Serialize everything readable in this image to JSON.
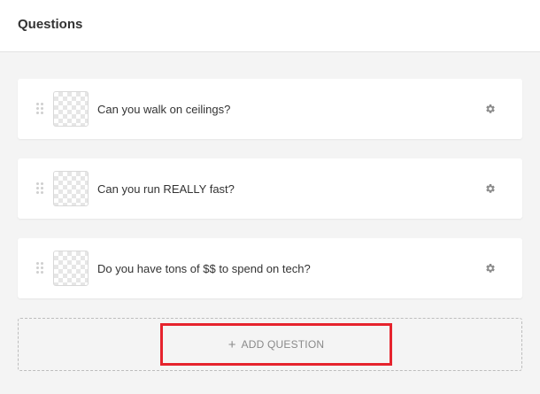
{
  "header": {
    "title": "Questions"
  },
  "questions": [
    {
      "text": "Can you walk on ceilings?"
    },
    {
      "text": "Can you run REALLY fast?"
    },
    {
      "text": "Do you have tons of $$ to spend on tech?"
    }
  ],
  "add_question": {
    "icon": "plus-icon",
    "label": "ADD QUESTION"
  },
  "colors": {
    "highlight": "#e6232d",
    "background": "#f4f4f4",
    "card": "#ffffff"
  }
}
